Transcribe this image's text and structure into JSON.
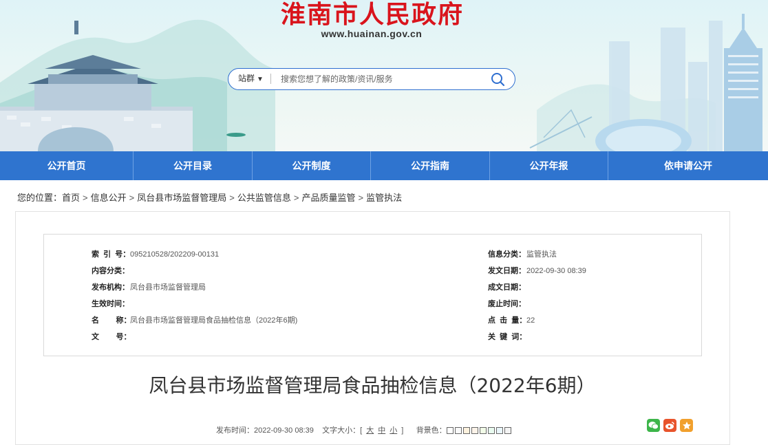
{
  "header": {
    "title": "淮南市人民政府",
    "url": "www.huainan.gov.cn"
  },
  "search": {
    "scope": "站群",
    "placeholder": "搜索您想了解的政策/资讯/服务"
  },
  "nav": {
    "items": [
      "公开首页",
      "公开目录",
      "公开制度",
      "公开指南",
      "公开年报",
      "依申请公开"
    ]
  },
  "breadcrumb": {
    "prefix": "您的位置：",
    "items": [
      "首页",
      "信息公开",
      "凤台县市场监督管理局",
      "公共监管信息",
      "产品质量监管",
      "监管执法"
    ]
  },
  "meta": {
    "index_label": "索  引  号：",
    "index_value": "095210528/202209-00131",
    "category_label": "信息分类：",
    "category_value": "监管执法",
    "content_label": "内容分类：",
    "content_value": "",
    "issue_date_label": "发文日期：",
    "issue_date_value": "2022-09-30 08:39",
    "publisher_label": "发布机构：",
    "publisher_value": "凤台县市场监督管理局",
    "created_label": "成文日期：",
    "created_value": "",
    "effective_label": "生效时间：",
    "effective_value": "",
    "expire_label": "废止时间：",
    "expire_value": "",
    "name_label": "名        称：",
    "name_value": "凤台县市场监督管理局食品抽检信息（2022年6期)",
    "clicks_label": "点  击  量：",
    "clicks_value": "22",
    "docno_label": "文        号：",
    "docno_value": "",
    "keywords_label": "关  键  词：",
    "keywords_value": ""
  },
  "article": {
    "title": "凤台县市场监督管理局食品抽检信息（2022年6期）",
    "publish_label": "发布时间：",
    "publish_time": "2022-09-30 08:39",
    "font_size_label": "文字大小：",
    "font_sizes": [
      "大",
      "中",
      "小"
    ],
    "bg_label": "背景色："
  },
  "colors": {
    "accent": "#2f74cf",
    "title_red": "#d9141c",
    "swatches": [
      "#ffffff",
      "#fafafa",
      "#fdf2de",
      "#fcf3e9",
      "#f2fce8",
      "#e9fbf0",
      "#eaf6fb",
      "#f4f4f4"
    ]
  },
  "share": [
    "wechat-icon",
    "weibo-icon",
    "favorite-icon"
  ]
}
